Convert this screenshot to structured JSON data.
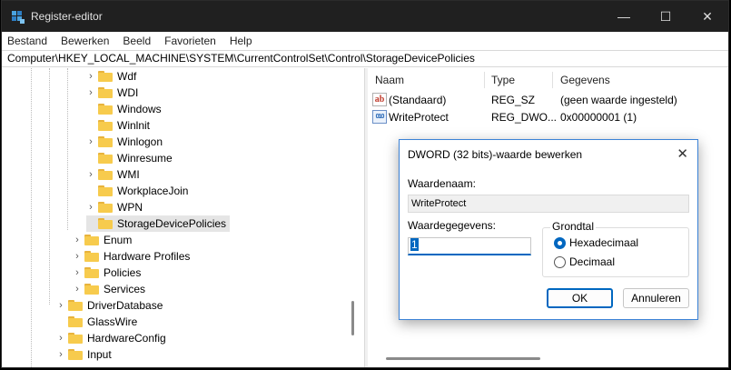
{
  "window": {
    "title": "Register-editor",
    "controls": {
      "minimize": "—",
      "maximize": "☐",
      "close": "✕"
    }
  },
  "menu": [
    "Bestand",
    "Bewerken",
    "Beeld",
    "Favorieten",
    "Help"
  ],
  "address": "Computer\\HKEY_LOCAL_MACHINE\\SYSTEM\\CurrentControlSet\\Control\\StorageDevicePolicies",
  "tree": {
    "items": [
      {
        "label": "Wdf",
        "expandable": true,
        "level": 2
      },
      {
        "label": "WDI",
        "expandable": true,
        "level": 2
      },
      {
        "label": "Windows",
        "expandable": false,
        "level": 2
      },
      {
        "label": "Winlnit",
        "expandable": false,
        "level": 2
      },
      {
        "label": "Winlogon",
        "expandable": true,
        "level": 2
      },
      {
        "label": "Winresume",
        "expandable": false,
        "level": 2
      },
      {
        "label": "WMI",
        "expandable": true,
        "level": 2
      },
      {
        "label": "WorkplaceJoin",
        "expandable": false,
        "level": 2
      },
      {
        "label": "WPN",
        "expandable": true,
        "level": 2
      },
      {
        "label": "StorageDevicePolicies",
        "expandable": false,
        "level": 2,
        "selected": true
      },
      {
        "label": "Enum",
        "expandable": true,
        "level": 1
      },
      {
        "label": "Hardware Profiles",
        "expandable": true,
        "level": 1
      },
      {
        "label": "Policies",
        "expandable": true,
        "level": 1
      },
      {
        "label": "Services",
        "expandable": true,
        "level": 1
      },
      {
        "label": "DriverDatabase",
        "expandable": true,
        "level": 0
      },
      {
        "label": "GlassWire",
        "expandable": false,
        "level": 0
      },
      {
        "label": "HardwareConfig",
        "expandable": true,
        "level": 0
      },
      {
        "label": "Input",
        "expandable": true,
        "level": 0
      }
    ]
  },
  "values_panel": {
    "columns": [
      "Naam",
      "Type",
      "Gegevens"
    ],
    "rows": [
      {
        "icon": "string-value-icon",
        "icon_text": "ab",
        "name": "(Standaard)",
        "type": "REG_SZ",
        "data": "(geen waarde ingesteld)"
      },
      {
        "icon": "binary-value-icon",
        "icon_text": "010",
        "name": "WriteProtect",
        "type": "REG_DWO...",
        "data": "0x00000001 (1)"
      }
    ]
  },
  "dialog": {
    "title": "DWORD (32 bits)-waarde bewerken",
    "close": "✕",
    "name_label": "Waardenaam:",
    "name_value": "WriteProtect",
    "data_label": "Waardegegevens:",
    "data_value": "1",
    "base_label": "Grondtal",
    "base_options": [
      {
        "label": "Hexadecimaal",
        "checked": true
      },
      {
        "label": "Decimaal",
        "checked": false
      }
    ],
    "ok_label": "OK",
    "cancel_label": "Annuleren"
  }
}
